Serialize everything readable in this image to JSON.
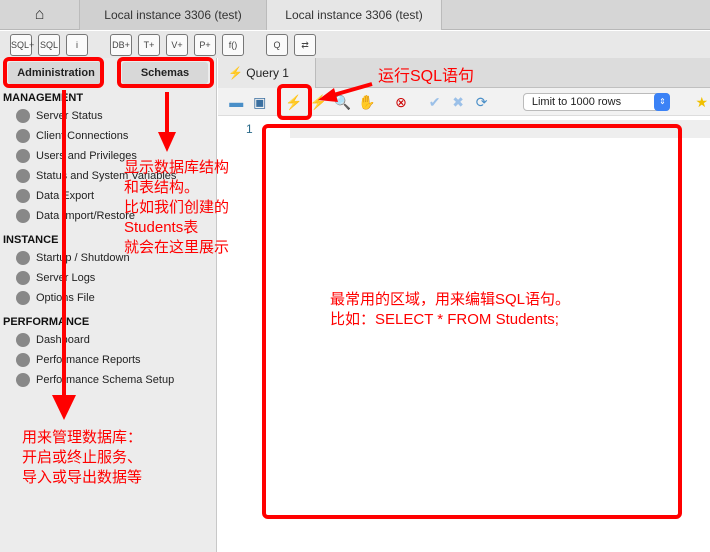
{
  "tabs": {
    "home_icon": "home-icon",
    "tab1": "Local instance 3306 (test)",
    "tab2": "Local instance 3306 (test)"
  },
  "toolbar": {
    "icons": [
      "SQL+",
      "SQL",
      "i",
      "DB+",
      "T+",
      "V+",
      "P+",
      "f()",
      "Q",
      "⇄"
    ]
  },
  "sidebar": {
    "tabs": [
      "Administration",
      "Schemas"
    ],
    "sections": [
      {
        "title": "MANAGEMENT",
        "items": [
          "Server Status",
          "Client Connections",
          "Users and Privileges",
          "Status and System Variables",
          "Data Export",
          "Data Import/Restore"
        ]
      },
      {
        "title": "INSTANCE",
        "items": [
          "Startup / Shutdown",
          "Server Logs",
          "Options File"
        ]
      },
      {
        "title": "PERFORMANCE",
        "items": [
          "Dashboard",
          "Performance Reports",
          "Performance Schema Setup"
        ]
      }
    ]
  },
  "query": {
    "tab": "Query 1",
    "limit": "Limit to 1000 rows",
    "line_number": "1"
  },
  "annotations": {
    "run": "运行SQL语句",
    "schemas": "显示数据库结构\n和表结构。\n比如我们创建的\nStudents表\n就会在这里展示",
    "editor": "最常用的区域，用来编辑SQL语句。\n比如：SELECT * FROM Students;",
    "admin": "用来管理数据库：\n开启或终止服务、\n导入或导出数据等"
  },
  "colors": {
    "annotation": "#ff0000"
  }
}
